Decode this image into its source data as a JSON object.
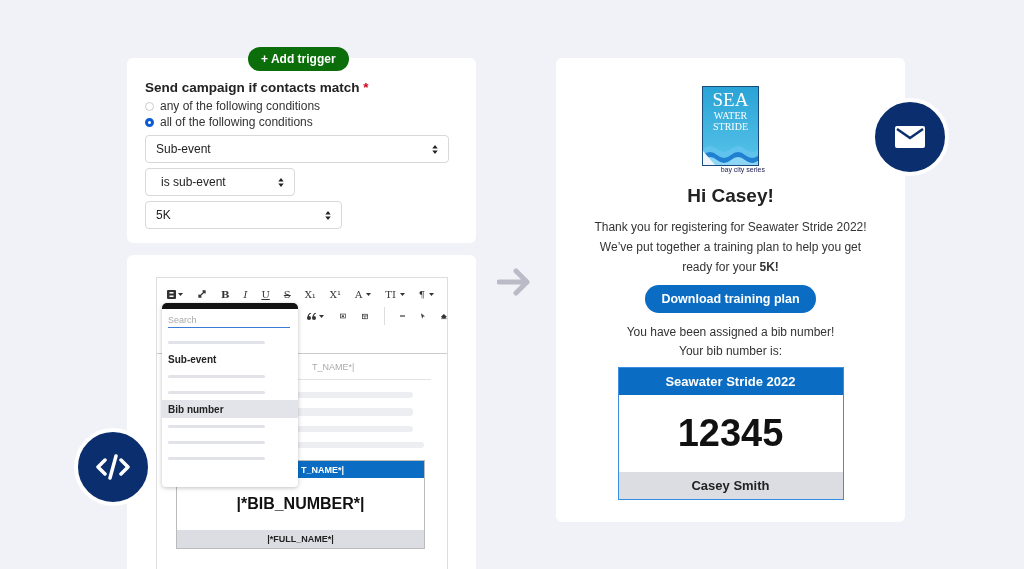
{
  "trigger_button": "+ Add trigger",
  "conditions": {
    "title": "Send campaign if contacts match",
    "required_mark": "*",
    "options": [
      {
        "label": "any of the following conditions",
        "selected": false
      },
      {
        "label": "all of the following conditions",
        "selected": true
      }
    ],
    "selects": [
      {
        "value": "Sub-event"
      },
      {
        "value": "is sub-event"
      },
      {
        "value": "5K"
      }
    ]
  },
  "editor": {
    "format_buttons": [
      {
        "label": "B",
        "kind": "bold",
        "menu": false
      },
      {
        "label": "I",
        "kind": "italic",
        "menu": false
      },
      {
        "label": "U",
        "kind": "underline",
        "menu": false
      },
      {
        "label": "S",
        "kind": "strike",
        "menu": false
      },
      {
        "label": "X₁",
        "kind": "plain",
        "menu": false
      },
      {
        "label": "X¹",
        "kind": "plain",
        "menu": false
      },
      {
        "label": "A",
        "kind": "plain",
        "menu": true
      },
      {
        "label": "TI",
        "kind": "plain",
        "menu": true
      },
      {
        "label": "¶",
        "kind": "plain",
        "menu": true
      }
    ],
    "merge_menu": {
      "placeholder": "Search",
      "items": [
        {
          "kind": "skeleton"
        },
        {
          "kind": "option",
          "label": "Sub-event",
          "selected": false
        },
        {
          "kind": "skeleton"
        },
        {
          "kind": "skeleton"
        },
        {
          "kind": "option",
          "label": "Bib number",
          "selected": true
        },
        {
          "kind": "skeleton"
        },
        {
          "kind": "skeleton"
        },
        {
          "kind": "skeleton"
        }
      ]
    },
    "content": {
      "merge_tag": "T_NAME*|",
      "bib_header": "T_NAME*|",
      "bib_number": "|*BIB_NUMBER*|",
      "bib_footer": "|*FULL_NAME*|"
    }
  },
  "email": {
    "logo": {
      "lines": [
        "SEA",
        "WATER",
        "STRIDE"
      ],
      "tagline": "bay city series"
    },
    "greeting": "Hi Casey!",
    "intro": "Thank you for registering for Seawater Stride 2022! We’ve put together a training plan to help you get ready for your **5K!**",
    "button": "Download training plan",
    "bib_intro": "You have been assigned a bib number! Your bib number is:",
    "bib": {
      "event": "Seawater Stride 2022",
      "number": "12345",
      "name": "Casey Smith"
    }
  }
}
